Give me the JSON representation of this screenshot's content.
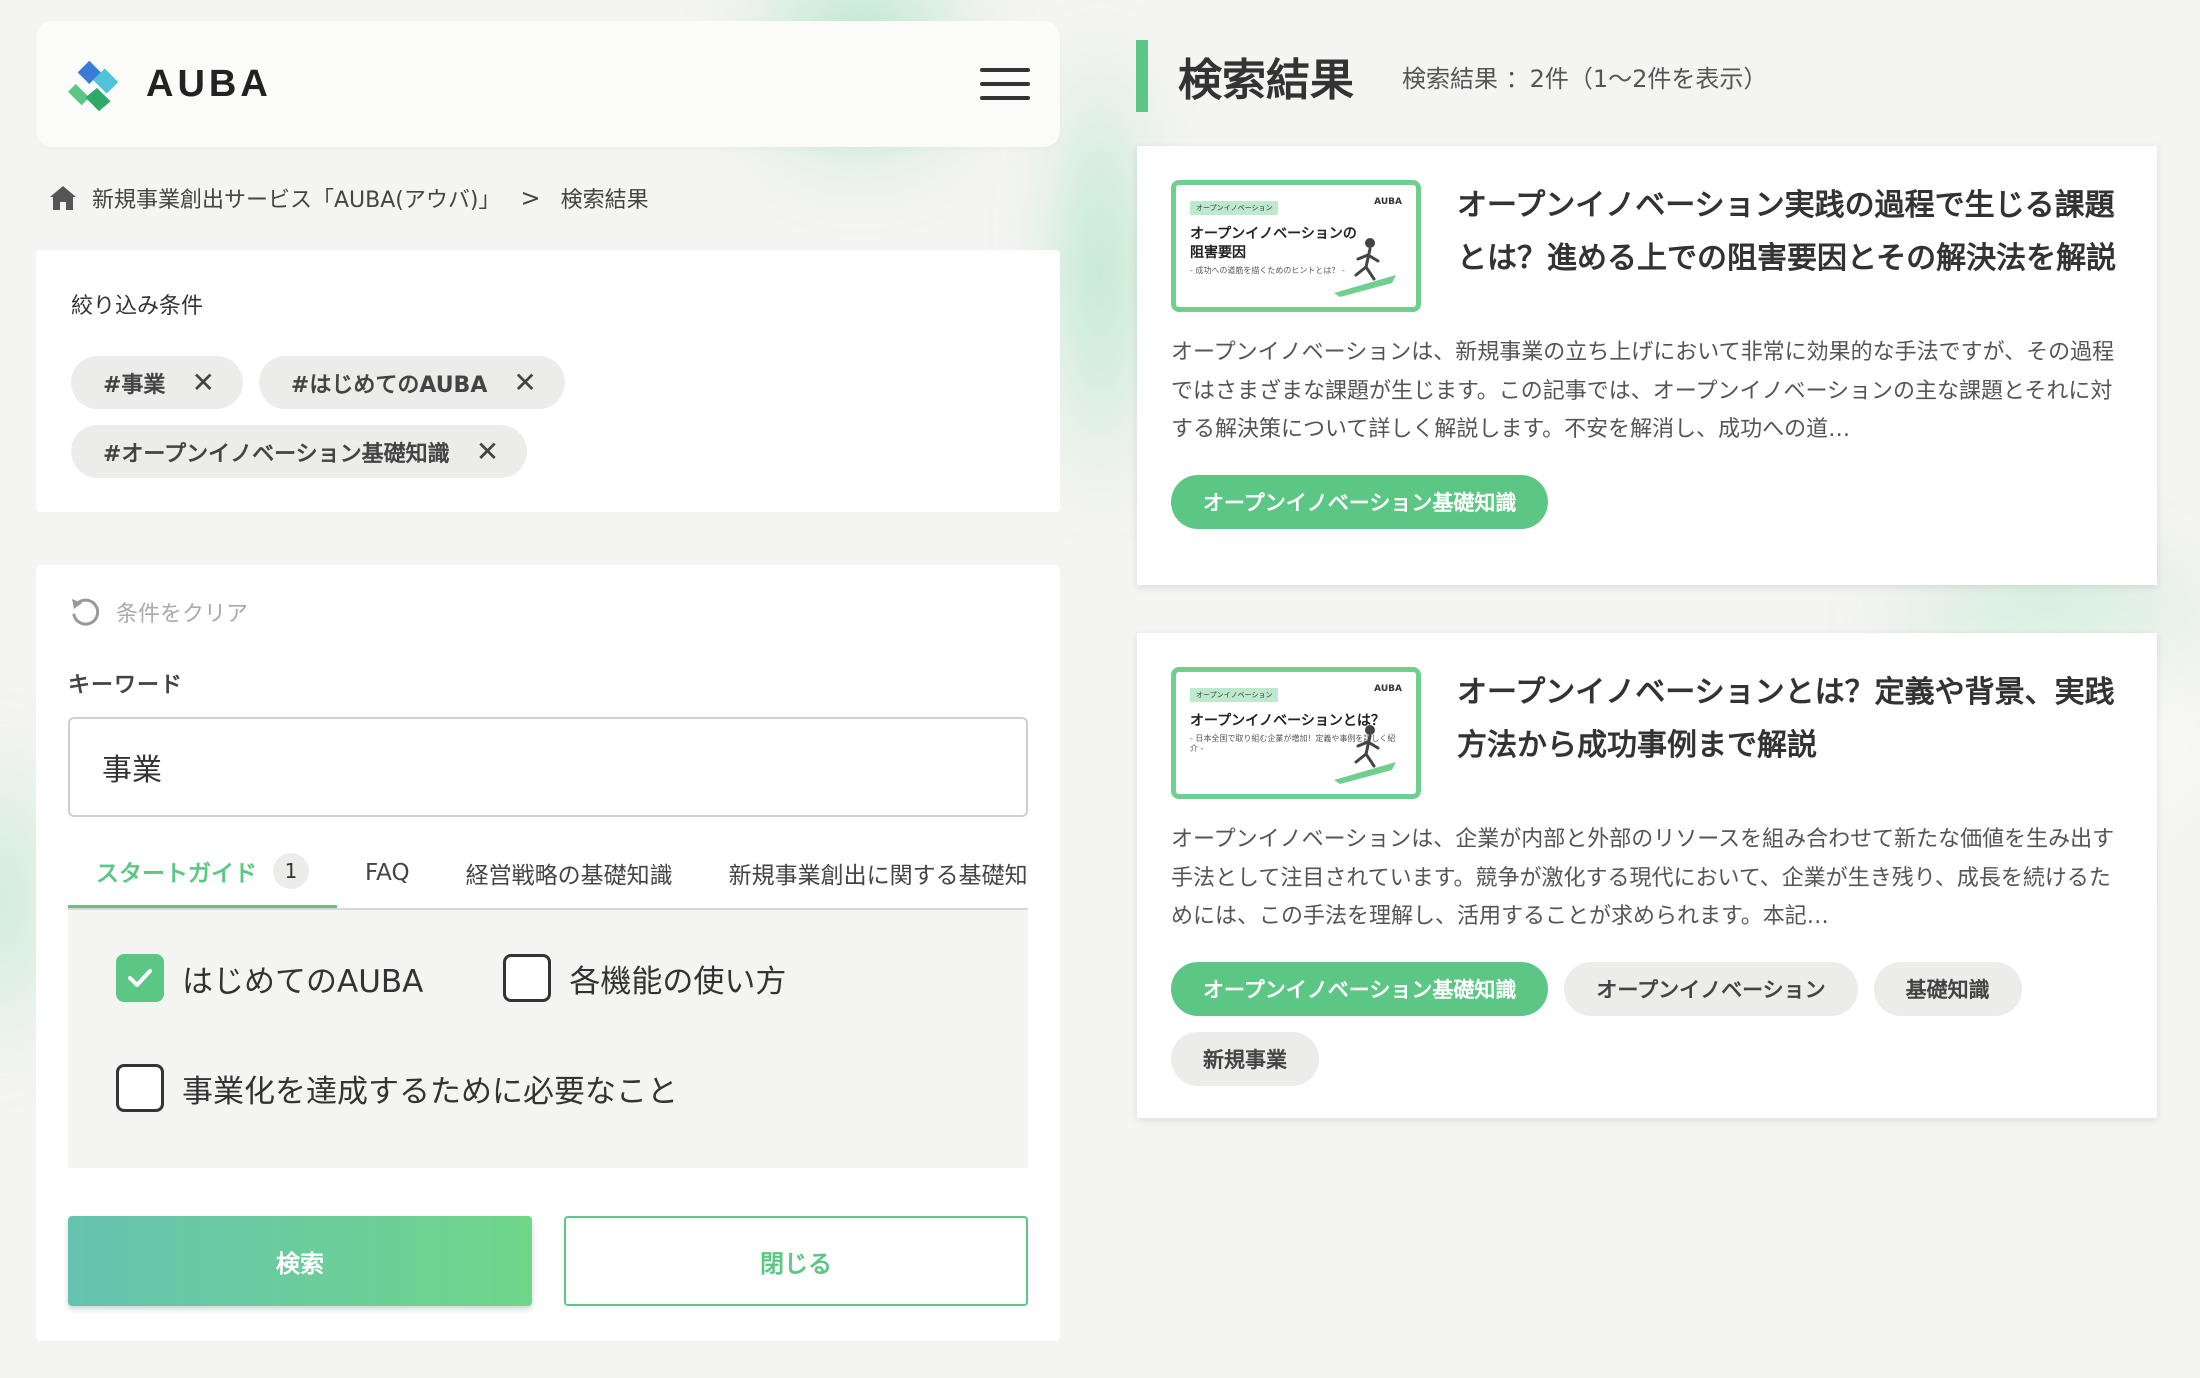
{
  "header": {
    "logo_text": "AUBA",
    "menu_icon": "hamburger-icon"
  },
  "breadcrumb": {
    "home_icon": "home-icon",
    "home_label": "新規事業創出サービス「AUBA(アウバ)」",
    "separator": ">",
    "current": "検索結果"
  },
  "filter": {
    "title": "絞り込み条件",
    "chips": [
      {
        "label": "#事業",
        "remove": "✕"
      },
      {
        "label": "#はじめてのAUBA",
        "remove": "✕"
      },
      {
        "label": "#オープンイノベーション基礎知識",
        "remove": "✕"
      }
    ]
  },
  "search": {
    "clear_label": "条件をクリア",
    "keyword_label": "キーワード",
    "keyword_value": "事業",
    "tabs": [
      {
        "label": "スタートガイド",
        "badge": "1"
      },
      {
        "label": "FAQ"
      },
      {
        "label": "経営戦略の基礎知識"
      },
      {
        "label": "新規事業創出に関する基礎知識"
      }
    ],
    "options": [
      {
        "label": "はじめてのAUBA",
        "checked": true
      },
      {
        "label": "各機能の使い方",
        "checked": false
      },
      {
        "label": "事業化を達成するために必要なこと",
        "checked": false
      }
    ],
    "search_button": "検索",
    "close_button": "閉じる"
  },
  "results": {
    "title": "検索結果",
    "count": "検索結果 ：2件（1〜2件を表示）",
    "accent_color": "#5cc784",
    "items": [
      {
        "thumb_tag": "オープンイノベーション",
        "thumb_logo": "AUBA",
        "thumb_title_line1": "オープンイノベーションの",
        "thumb_title_line2": "阻害要因",
        "thumb_sub": "- 成功への道筋を描くためのヒントとは？ -",
        "title": "オープンイノベーション実践の過程で生じる課題とは？進める上での阻害要因とその解決法を解説",
        "description": "オープンイノベーションは、新規事業の立ち上げにおいて非常に効果的な手法ですが、その過程ではさまざまな課題が生じます。この記事では、オープンイノベーションの主な課題とそれに対する解決策について詳しく解説します。不安を解消し、成功への道…",
        "tags": [
          {
            "label": "オープンイノベーション基礎知識",
            "style": "green"
          }
        ]
      },
      {
        "thumb_tag": "オープンイノベーション",
        "thumb_logo": "AUBA",
        "thumb_title_line1": "オープンイノベーションとは？",
        "thumb_title_line2": "",
        "thumb_sub": "- 日本全国で取り組む企業が増加！定義や事例を詳しく紹介 -",
        "title": "オープンイノベーションとは？定義や背景、実践方法から成功事例まで解説",
        "description": "オープンイノベーションは、企業が内部と外部のリソースを組み合わせて新たな価値を生み出す手法として注目されています。競争が激化する現代において、企業が生き残り、成長を続けるためには、この手法を理解し、活用することが求められます。本記…",
        "tags": [
          {
            "label": "オープンイノベーション基礎知識",
            "style": "green"
          },
          {
            "label": "オープンイノベーション",
            "style": "gray"
          },
          {
            "label": "基礎知識",
            "style": "gray"
          },
          {
            "label": "新規事業",
            "style": "gray"
          }
        ]
      }
    ]
  }
}
